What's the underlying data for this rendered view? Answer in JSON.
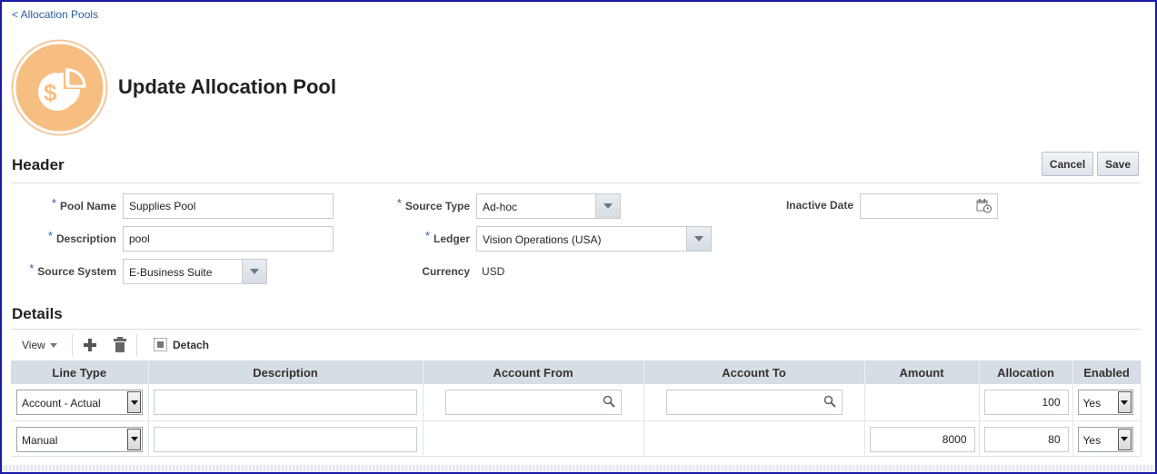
{
  "nav": {
    "back_link": "< Allocation Pools"
  },
  "page": {
    "title": "Update Allocation Pool",
    "icon": "allocation-pool-icon"
  },
  "header_section": {
    "title": "Header",
    "cancel_label": "Cancel",
    "save_label": "Save",
    "fields": {
      "pool_name": {
        "label": "Pool Name",
        "value": "Supplies Pool",
        "required": "*"
      },
      "description": {
        "label": "Description",
        "value": "pool",
        "required": "*"
      },
      "source_system": {
        "label": "Source System",
        "value": "E-Business Suite",
        "required": "*"
      },
      "source_type": {
        "label": "Source Type",
        "value": "Ad-hoc",
        "required": "*"
      },
      "ledger": {
        "label": "Ledger",
        "value": "Vision Operations (USA)",
        "required": "*"
      },
      "currency": {
        "label": "Currency",
        "value": "USD"
      },
      "inactive_date": {
        "label": "Inactive Date",
        "value": ""
      }
    }
  },
  "details_section": {
    "title": "Details",
    "toolbar": {
      "view_label": "View",
      "detach_label": "Detach"
    },
    "columns": [
      "Line Type",
      "Description",
      "Account From",
      "Account To",
      "Amount",
      "Allocation",
      "Enabled"
    ],
    "rows": [
      {
        "line_type": "Account - Actual",
        "description": "",
        "account_from": "",
        "account_to": "",
        "amount": "",
        "allocation": "100",
        "enabled": "Yes"
      },
      {
        "line_type": "Manual",
        "description": "",
        "account_from": "",
        "account_to": "",
        "amount": "8000",
        "allocation": "80",
        "enabled": "Yes"
      }
    ]
  },
  "colors": {
    "accent": "#2e5fa3",
    "icon_orange": "#f7be82",
    "header_bg": "#d6dde4"
  }
}
